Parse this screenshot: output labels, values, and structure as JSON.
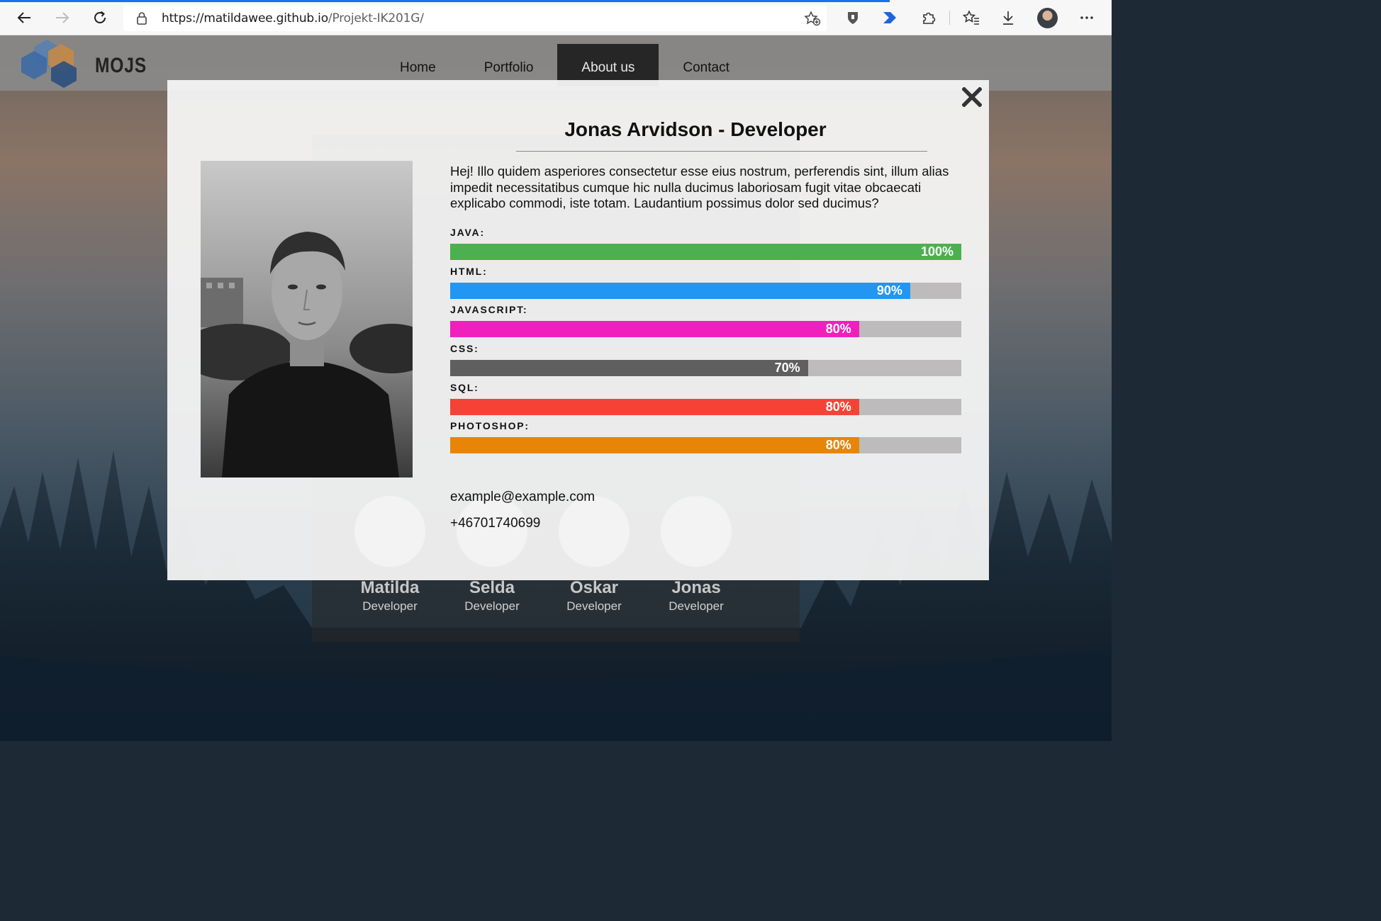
{
  "browser": {
    "url_host": "https://matildawee.github.io",
    "url_path": "/Projekt-IK201G/"
  },
  "site": {
    "logo_text": "MOJS",
    "nav": [
      {
        "label": "Home",
        "active": false
      },
      {
        "label": "Portfolio",
        "active": false
      },
      {
        "label": "About us",
        "active": true
      },
      {
        "label": "Contact",
        "active": false
      }
    ],
    "team_behind": [
      {
        "name": "Matilda",
        "role": "Developer"
      },
      {
        "name": "Selda",
        "role": "Developer"
      },
      {
        "name": "Oskar",
        "role": "Developer"
      },
      {
        "name": "Jonas",
        "role": "Developer"
      }
    ]
  },
  "modal": {
    "title": "Jonas Arvidson - Developer",
    "bio": "Hej! Illo quidem asperiores consectetur esse eius nostrum, perferendis sint, illum alias impedit necessitatibus cumque hic nulla ducimus laboriosam fugit vitae obcaecati explicabo commodi, iste totam. Laudantium possimus dolor sed ducimus?",
    "skills": [
      {
        "label": "JAVA:",
        "percent": 100,
        "value_text": "100%",
        "color": "#4caf50"
      },
      {
        "label": "HTML:",
        "percent": 90,
        "value_text": "90%",
        "color": "#2196f3"
      },
      {
        "label": "JAVASCRIPT:",
        "percent": 80,
        "value_text": "80%",
        "color": "#f020bd"
      },
      {
        "label": "CSS:",
        "percent": 70,
        "value_text": "70%",
        "color": "#5f5f5f"
      },
      {
        "label": "SQL:",
        "percent": 80,
        "value_text": "80%",
        "color": "#f44336"
      },
      {
        "label": "PHOTOSHOP:",
        "percent": 80,
        "value_text": "80%",
        "color": "#e88506"
      }
    ],
    "email": "example@example.com",
    "phone": "+46701740699"
  },
  "icons": {
    "close": "close-icon",
    "back": "back-arrow-icon",
    "forward": "forward-arrow-icon",
    "refresh": "refresh-icon",
    "lock": "lock-icon"
  }
}
